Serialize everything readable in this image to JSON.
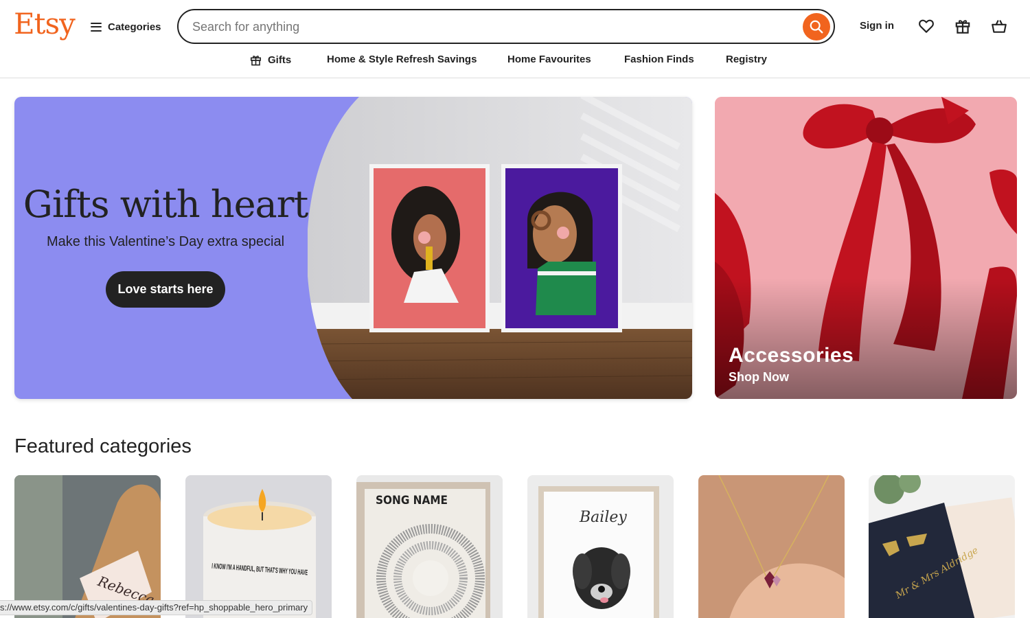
{
  "header": {
    "logo": "Etsy",
    "categories_label": "Categories",
    "search_placeholder": "Search for anything",
    "search_value": "",
    "signin_label": "Sign in"
  },
  "nav": {
    "items": [
      "Gifts",
      "Home & Style Refresh Savings",
      "Home Favourites",
      "Fashion Finds",
      "Registry"
    ]
  },
  "hero": {
    "title": "Gifts with heart",
    "subtitle": "Make this Valentine’s Day extra special",
    "button": "Love starts here"
  },
  "side_banner": {
    "title": "Accessories",
    "subtitle": "Shop Now"
  },
  "featured": {
    "title": "Featured categories",
    "tiles": [
      {
        "label": "Rebecca"
      },
      {
        "label": "I KNOW I'M A HANDFUL, BUT THAT'S WHY YOU HAVE"
      },
      {
        "label": "SONG NAME"
      },
      {
        "label": "Bailey"
      },
      {
        "label": "necklace"
      },
      {
        "label": "Mr & Mrs Aldridge"
      }
    ]
  },
  "status_bar": {
    "url": "s://www.etsy.com/c/gifts/valentines-day-gifts?ref=hp_shoppable_hero_primary"
  },
  "colors": {
    "brand": "#f1641e",
    "hero_bg": "#8c8cf0",
    "text": "#222222"
  }
}
